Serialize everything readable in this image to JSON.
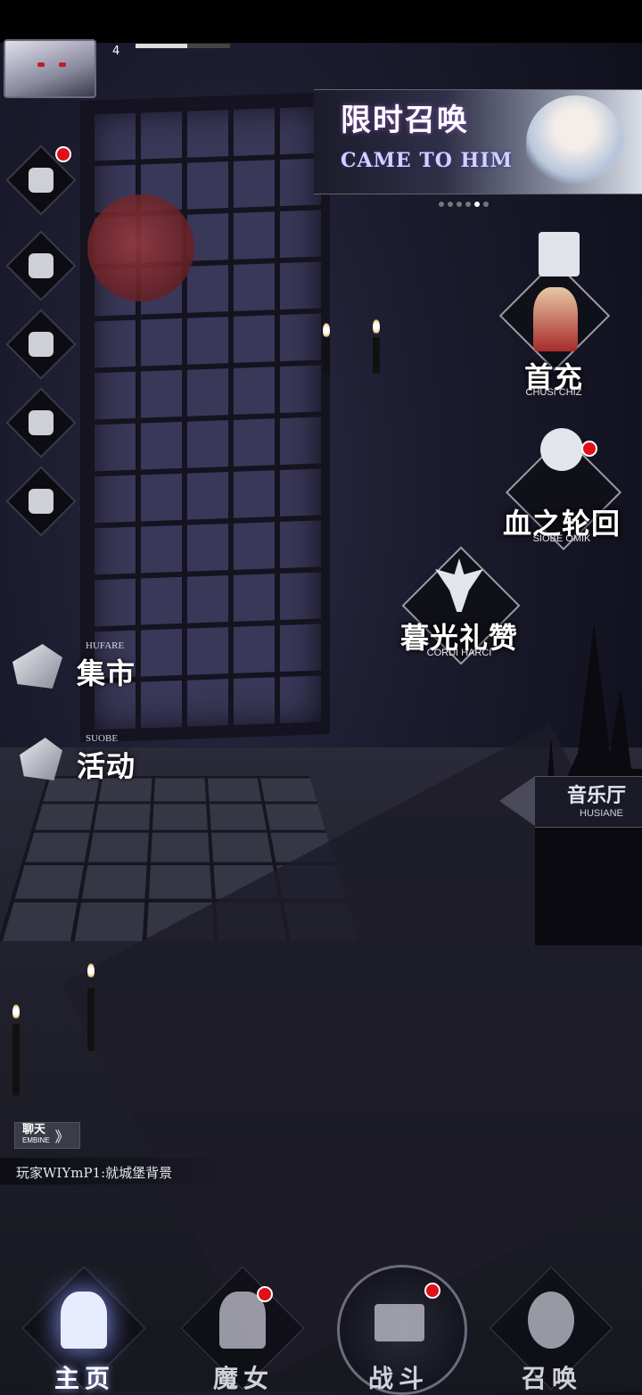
{
  "player": {
    "level": "4",
    "xp_fraction": 0.55
  },
  "banner": {
    "title": "限时召唤",
    "subtitle": "CAME TO HIM",
    "page_count": 6,
    "active_page": 5
  },
  "left_menu": {
    "icons": [
      "scroll-icon",
      "mail-icon",
      "ghost-icon",
      "bag-icon",
      "map-scroll-icon"
    ]
  },
  "market": {
    "small": "HUFARE",
    "big": "集市"
  },
  "activity": {
    "small": "SUOBE",
    "big": "活动"
  },
  "first_charge": {
    "big": "首充",
    "small": "CHUSI CHIZ"
  },
  "blood_cycle": {
    "big": "血之轮回",
    "small": "SIOBE OMIK"
  },
  "twilight": {
    "big": "暮光礼赞",
    "small": "CORDI HARCI"
  },
  "music_hall": {
    "big": "音乐厅",
    "small": "HUSIANE"
  },
  "chat": {
    "button_big": "聊天",
    "button_small": "EMBINE",
    "chevron": "》",
    "message": "玩家WIYmP1:就城堡背景"
  },
  "nav": {
    "home": "主页",
    "witch": "魔女",
    "battle": "战斗",
    "summon": "召唤"
  },
  "colors": {
    "notification": "#e0101a",
    "moon": "#9a3a3e"
  }
}
